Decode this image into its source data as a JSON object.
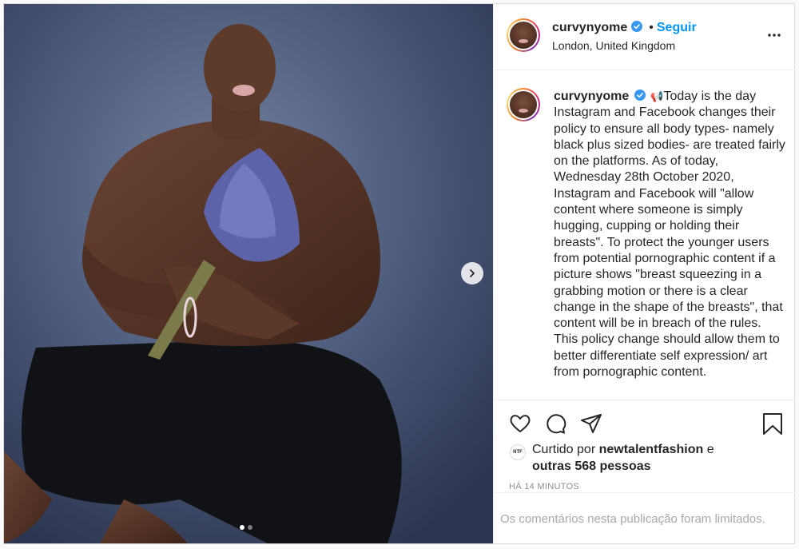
{
  "post": {
    "author": {
      "username": "curvynyome",
      "verified": true,
      "location": "London, United Kingdom",
      "avatar_icon": "profile-avatar"
    },
    "header": {
      "bullet": "•",
      "follow_label": "Seguir",
      "more_icon": "more-options-icon"
    },
    "media": {
      "description_icon": "post-photo",
      "carousel_current": 1,
      "carousel_total": 2,
      "next_icon": "chevron-right-icon"
    },
    "caption": {
      "username": "curvynyome",
      "emoji_icon": "megaphone-icon",
      "text": "Today is the day Instagram and Facebook changes their policy to ensure all body types- namely black plus sized bodies- are treated fairly on the platforms. As of today, Wednesday 28th October 2020, Instagram and Facebook will \"allow content where someone is simply hugging, cupping or holding their breasts\". To protect the younger users from potential pornographic content if a picture shows \"breast squeezing in a grabbing motion or there is a clear change in the shape of the breasts\", that content will be in breach of the rules. This policy change should allow them to better differentiate self expression/ art from pornographic content."
    },
    "actions": {
      "like_icon": "heart-icon",
      "comment_icon": "comment-icon",
      "share_icon": "share-icon",
      "save_icon": "bookmark-icon"
    },
    "likes": {
      "liker_avatar_text": "NTF",
      "prefix": "Curtido por",
      "liker": "newtalentfashion",
      "conjunction": "e",
      "others": "outras 568 pessoas"
    },
    "timestamp": "HÁ 14 MINUTOS",
    "comments_limited": "Os comentários nesta publicação foram limitados."
  },
  "colors": {
    "accent_blue": "#0095f6",
    "text": "#262626",
    "muted": "#8e8e8e",
    "border": "#dbdbdb"
  }
}
